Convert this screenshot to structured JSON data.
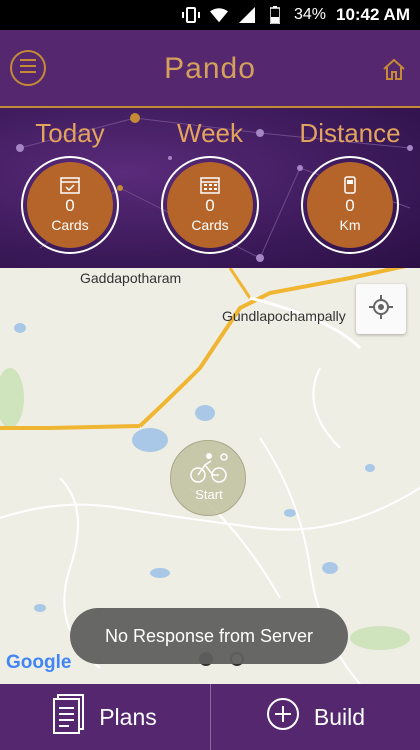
{
  "status_bar": {
    "battery": "34%",
    "time": "10:42 AM"
  },
  "app_bar": {
    "title": "Pando"
  },
  "stats": [
    {
      "title": "Today",
      "value": "0",
      "unit": "Cards",
      "icon": "calendar-check-icon"
    },
    {
      "title": "Week",
      "value": "0",
      "unit": "Cards",
      "icon": "calendar-grid-icon"
    },
    {
      "title": "Distance",
      "value": "0",
      "unit": "Km",
      "icon": "fuel-pump-icon"
    }
  ],
  "map": {
    "labels": {
      "gaddapotharam": "Gaddapotharam",
      "gundlapochampally": "Gundlapochampally",
      "start": "Start"
    },
    "google": "Google",
    "toast": "No Response from Server"
  },
  "bottom_bar": {
    "plans": "Plans",
    "build": "Build"
  },
  "colors": {
    "primary": "#55276f",
    "accent": "#c58a35",
    "disc": "#b5652a"
  }
}
